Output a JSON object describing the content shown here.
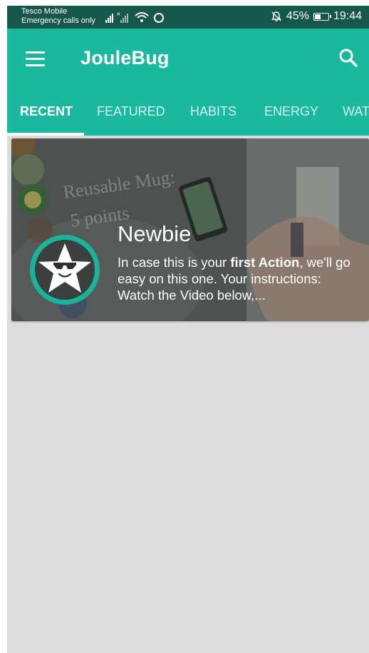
{
  "status_bar": {
    "carrier": "Tesco Mobile",
    "emergency": "Emergency calls only",
    "battery": "45%",
    "battery_level": 0.45,
    "time": "19:44"
  },
  "app_bar": {
    "title": "JouleBug",
    "menu_icon": "hamburger-menu-icon",
    "search_icon": "search-icon"
  },
  "tabs": [
    {
      "label": "RECENT",
      "active": true
    },
    {
      "label": "FEATURED",
      "active": false
    },
    {
      "label": "HABITS",
      "active": false
    },
    {
      "label": "ENERGY",
      "active": false
    },
    {
      "label": "WAT",
      "active": false
    }
  ],
  "card": {
    "title": "Newbie",
    "desc_before": "In case this is your ",
    "desc_bold": "first Action",
    "desc_after": ", we'll go easy on this one. Your instructions: Watch the Video below,...",
    "background_text_1": "Reusable Mug:",
    "background_text_2": "5 points",
    "badge_icon": "star-sunglasses-badge-icon"
  },
  "colors": {
    "app_bar": "#1ab99f",
    "status_bar": "#15574a",
    "badge_ring": "#19b49a",
    "content_bg": "#dcdcdc"
  }
}
